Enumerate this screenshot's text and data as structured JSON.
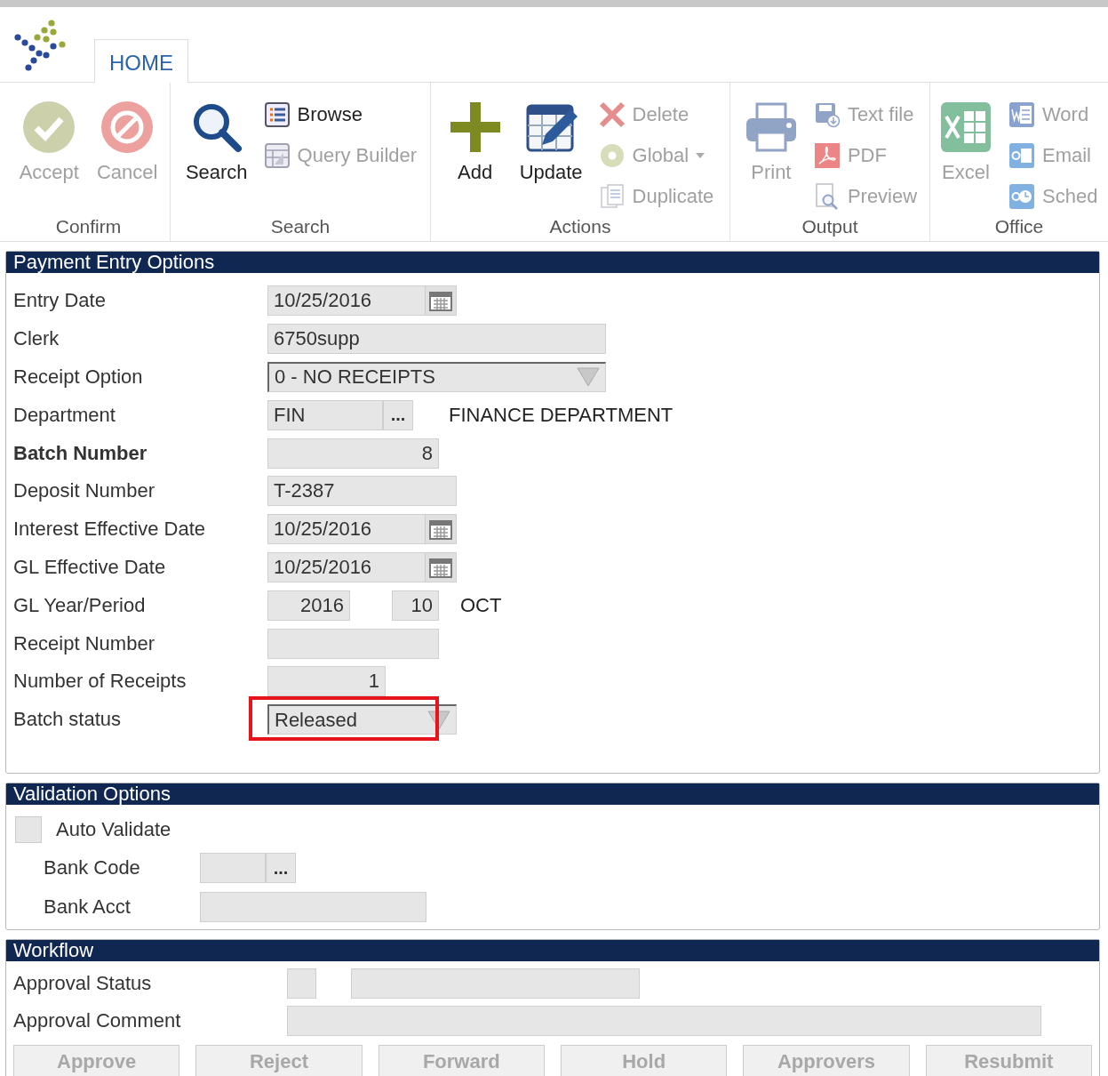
{
  "tabs": [
    {
      "label": "HOME",
      "selected": true
    }
  ],
  "ribbon": {
    "groups": [
      {
        "label": "Confirm",
        "items": [
          {
            "kind": "large",
            "label": "Accept",
            "disabled": true,
            "dropdown": false
          },
          {
            "kind": "large",
            "label": "Cancel",
            "disabled": true,
            "dropdown": false
          }
        ]
      },
      {
        "label": "Search",
        "items": [
          {
            "kind": "large",
            "label": "Search",
            "disabled": false,
            "dropdown": false
          },
          {
            "kind": "small",
            "label": "Browse",
            "disabled": false,
            "dropdown": false
          },
          {
            "kind": "small",
            "label": "Query Builder",
            "disabled": true,
            "dropdown": false
          }
        ]
      },
      {
        "label": "Actions",
        "items": [
          {
            "kind": "large",
            "label": "Add",
            "disabled": false,
            "dropdown": false
          },
          {
            "kind": "large",
            "label": "Update",
            "disabled": false,
            "dropdown": false
          },
          {
            "kind": "small",
            "label": "Delete",
            "disabled": true,
            "dropdown": false
          },
          {
            "kind": "small",
            "label": "Global",
            "disabled": true,
            "dropdown": true
          },
          {
            "kind": "small",
            "label": "Duplicate",
            "disabled": true,
            "dropdown": false
          }
        ]
      },
      {
        "label": "Output",
        "items": [
          {
            "kind": "large",
            "label": "Print",
            "disabled": true,
            "dropdown": false
          },
          {
            "kind": "small",
            "label": "Text file",
            "disabled": true,
            "dropdown": false
          },
          {
            "kind": "small",
            "label": "PDF",
            "disabled": true,
            "dropdown": false
          },
          {
            "kind": "small",
            "label": "Preview",
            "disabled": true,
            "dropdown": false
          }
        ]
      },
      {
        "label": "Office",
        "items": [
          {
            "kind": "large",
            "label": "Excel",
            "disabled": true,
            "dropdown": false
          },
          {
            "kind": "small",
            "label": "Word",
            "disabled": true,
            "dropdown": false
          },
          {
            "kind": "small",
            "label": "Email",
            "disabled": true,
            "dropdown": false
          },
          {
            "kind": "small",
            "label": "Sched",
            "disabled": true,
            "dropdown": false
          }
        ]
      }
    ]
  },
  "payment_entry_options": {
    "title": "Payment Entry Options",
    "rows": [
      {
        "label": "Entry Date",
        "kind": "date",
        "value": "10/25/2016",
        "required": false,
        "highlighted": false
      },
      {
        "label": "Clerk",
        "kind": "text",
        "value": "6750supp",
        "required": false,
        "highlighted": false
      },
      {
        "label": "Receipt Option",
        "kind": "select",
        "value": "0 - NO RECEIPTS",
        "required": false,
        "highlighted": false
      },
      {
        "label": "Department",
        "kind": "lookup",
        "value": "FIN",
        "button_label": "...",
        "description": "FINANCE DEPARTMENT",
        "required": false,
        "highlighted": false
      },
      {
        "label": "Batch Number",
        "kind": "number",
        "value": "8",
        "required": true,
        "highlighted": false
      },
      {
        "label": "Deposit Number",
        "kind": "text",
        "value": "T-2387",
        "required": false,
        "highlighted": false
      },
      {
        "label": "Interest Effective Date",
        "kind": "date",
        "value": "10/25/2016",
        "required": false,
        "highlighted": false
      },
      {
        "label": "GL Effective Date",
        "kind": "date",
        "value": "10/25/2016",
        "required": false,
        "highlighted": false
      },
      {
        "label": "GL Year/Period",
        "kind": "period",
        "year": "2016",
        "period": "10",
        "month": "OCT",
        "required": false,
        "highlighted": false
      },
      {
        "label": "Receipt Number",
        "kind": "text",
        "required": false,
        "highlighted": false
      },
      {
        "label": "Number of Receipts",
        "kind": "number",
        "value": "1",
        "required": false,
        "highlighted": false
      },
      {
        "label": "Batch status",
        "kind": "select",
        "value": "Released",
        "required": false,
        "highlighted": true
      }
    ]
  },
  "validation_options": {
    "title": "Validation Options",
    "auto_validate": {
      "label": "Auto Validate",
      "checked": false
    },
    "bank_code": {
      "label": "Bank Code",
      "button_label": "..."
    },
    "bank_acct": {
      "label": "Bank Acct"
    }
  },
  "workflow": {
    "title": "Workflow",
    "approval_status": {
      "label": "Approval Status"
    },
    "approval_comment": {
      "label": "Approval Comment"
    },
    "buttons": [
      {
        "label": "Approve",
        "disabled": true
      },
      {
        "label": "Reject",
        "disabled": true
      },
      {
        "label": "Forward",
        "disabled": true
      },
      {
        "label": "Hold",
        "disabled": true
      },
      {
        "label": "Approvers",
        "disabled": true
      },
      {
        "label": "Resubmit",
        "disabled": true
      }
    ]
  }
}
